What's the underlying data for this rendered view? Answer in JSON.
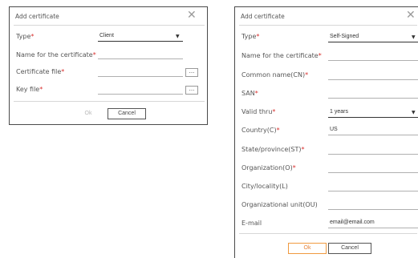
{
  "dialog1": {
    "title": "Add certificate",
    "close_glyph": "✕",
    "type_label": "Type",
    "type_value": "Client",
    "name_label": "Name for the certificate",
    "cert_label": "Certificate file",
    "key_label": "Key file",
    "browse_label": "...",
    "ok_label": "Ok",
    "cancel_label": "Cancel"
  },
  "dialog2": {
    "title": "Add certificate",
    "close_glyph": "✕",
    "type_label": "Type",
    "type_value": "Self-Signed",
    "name_label": "Name for the certificate",
    "cn_label": "Common name(CN)",
    "san_label": "SAN",
    "valid_label": "Valid thru",
    "valid_value": "1 years",
    "country_label": "Country(C)",
    "country_value": "US",
    "state_label": "State/province(ST)",
    "org_label": "Organization(O)",
    "city_label": "City/locality(L)",
    "ou_label": "Organizational unit(OU)",
    "email_label": "E-mail",
    "email_value": "email@email.com",
    "ok_label": "Ok",
    "cancel_label": "Cancel"
  },
  "required_mark": "*",
  "icons": {
    "close": "close-icon",
    "chevron": "chevron-down-icon"
  },
  "colors": {
    "required": "#d9302e",
    "ok_accent": "#f09a40",
    "border": "#4a4a4a"
  }
}
